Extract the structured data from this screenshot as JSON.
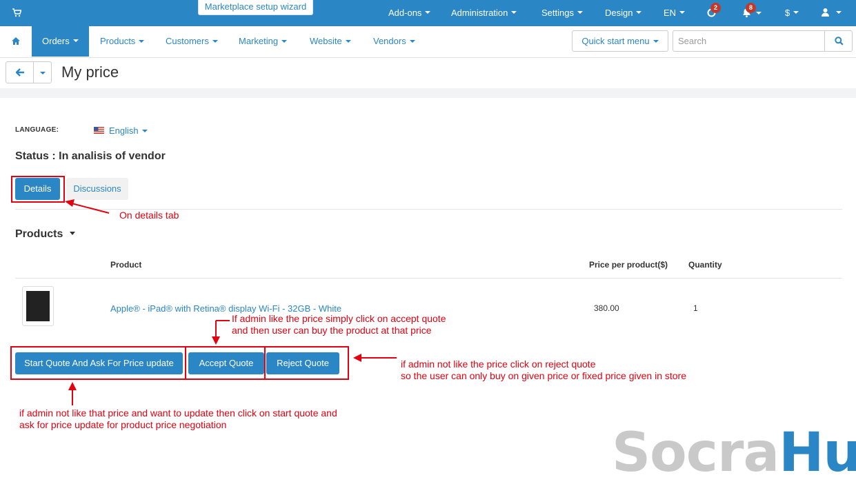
{
  "topbar": {
    "wizard_label": "Marketplace setup wizard",
    "menus": [
      "Add-ons",
      "Administration",
      "Settings",
      "Design",
      "EN"
    ],
    "updates_badge": "2",
    "notifications_badge": "8",
    "currency": "$",
    "bg_color": "#2b86c5"
  },
  "navbar": {
    "items": [
      "Orders",
      "Products",
      "Customers",
      "Marketing",
      "Website",
      "Vendors"
    ],
    "active": "Orders",
    "quick_start": "Quick start menu",
    "search_placeholder": "Search"
  },
  "page": {
    "title": "My price",
    "language_label": "LANGUAGE:",
    "language_value": "English",
    "status": "Status : In analisis of vendor",
    "tabs": [
      "Details",
      "Discussions"
    ],
    "active_tab": "Details",
    "products_heading": "Products"
  },
  "table": {
    "headers": {
      "product": "Product",
      "price": "Price per product($)",
      "quantity": "Quantity"
    },
    "rows": [
      {
        "name": "Apple® - iPad® with Retina® display Wi-Fi - 32GB - White",
        "price": "380.00",
        "quantity": "1"
      }
    ]
  },
  "buttons": {
    "start_quote": "Start Quote And Ask For Price update",
    "accept_quote": "Accept Quote",
    "reject_quote": "Reject Quote"
  },
  "annotations": {
    "details_note": "On details tab",
    "accept_note_1": "If admin like the price simply click on accept quote",
    "accept_note_2": "and then user can buy the product at that price",
    "reject_note_1": "if admin not like the price click on reject quote",
    "reject_note_2": "so the user can only buy on given price or fixed price given in store",
    "start_note_1": "if admin not like that price and want to update then click on start quote and",
    "start_note_2": "ask for price update for product price negotiation",
    "color": "#e3000f"
  },
  "watermark": {
    "part1": "Socra",
    "part2": "Hub"
  }
}
